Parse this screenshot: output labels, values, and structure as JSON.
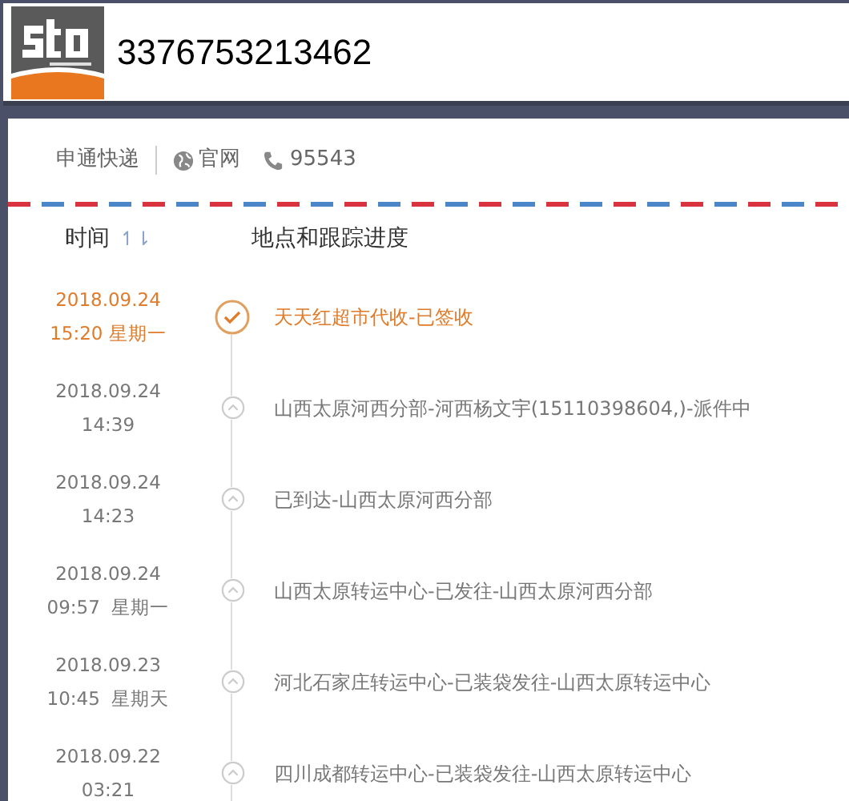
{
  "header": {
    "tracking_number": "3376753213462"
  },
  "carrier": {
    "name": "申通快递",
    "website": "官网",
    "phone": "95543"
  },
  "columns": {
    "time": "时间",
    "sort_icon": "↿⇂",
    "progress": "地点和跟踪进度"
  },
  "events": [
    {
      "date": "2018.09.24",
      "time": "15:20 星期一",
      "text": "天天红超市代收-已签收",
      "current": true
    },
    {
      "date": "2018.09.24",
      "time": "14:39",
      "text": "山西太原河西分部-河西杨文宇(15110398604,)-派件中",
      "current": false
    },
    {
      "date": "2018.09.24",
      "time": "14:23",
      "text": "已到达-山西太原河西分部",
      "current": false
    },
    {
      "date": "2018.09.24",
      "time": "09:57  星期一",
      "text": "山西太原转运中心-已发往-山西太原河西分部",
      "current": false
    },
    {
      "date": "2018.09.23",
      "time": "10:45  星期天",
      "text": "河北石家庄转运中心-已装袋发往-山西太原转运中心",
      "current": false
    },
    {
      "date": "2018.09.22",
      "time": "03:21",
      "text": "四川成都转运中心-已装袋发往-山西太原转运中心",
      "current": false
    }
  ]
}
